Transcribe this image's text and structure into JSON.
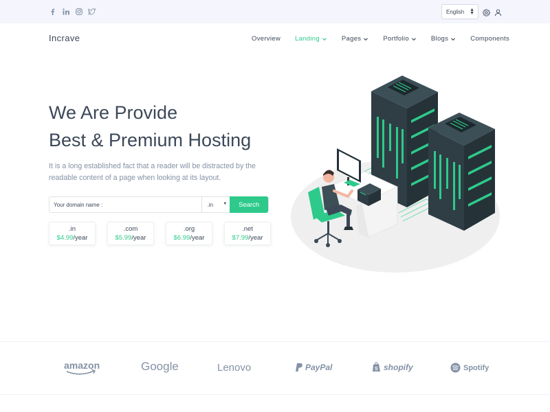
{
  "topbar": {
    "social": [
      "facebook-icon",
      "linkedin-icon",
      "instagram-icon",
      "twitter-icon"
    ],
    "language": "English"
  },
  "brand": "Incrave",
  "nav": [
    {
      "label": "Overview",
      "dropdown": false,
      "active": false
    },
    {
      "label": "Landing",
      "dropdown": true,
      "active": true
    },
    {
      "label": "Pages",
      "dropdown": true,
      "active": false
    },
    {
      "label": "Portfolio",
      "dropdown": true,
      "active": false
    },
    {
      "label": "Blogs",
      "dropdown": true,
      "active": false
    },
    {
      "label": "Components",
      "dropdown": false,
      "active": false
    }
  ],
  "hero": {
    "title_line1": "We Are Provide",
    "title_line2": "Best & Premium Hosting",
    "description": "It is a long established fact that a reader will be distracted by the readable content of a page when looking at its layout."
  },
  "domain_search": {
    "placeholder": "Your domain name :",
    "tld": ".in",
    "button": "Search"
  },
  "prices": [
    {
      "tld": ".in",
      "price": "$4.99",
      "period": "/year"
    },
    {
      "tld": ".com",
      "price": "$5.99",
      "period": "/year"
    },
    {
      "tld": ".org",
      "price": "$6.99",
      "period": "/year"
    },
    {
      "tld": ".net",
      "price": "$7.99",
      "period": "/year"
    }
  ],
  "partners": [
    "amazon",
    "Google",
    "Lenovo",
    "PayPal",
    "shopify",
    "Spotify"
  ],
  "colors": {
    "accent": "#2eca8b",
    "text": "#3c4858",
    "muted": "#8492a6",
    "topbar_bg": "#f4f5fd",
    "server_dark": "#2f3d44"
  }
}
